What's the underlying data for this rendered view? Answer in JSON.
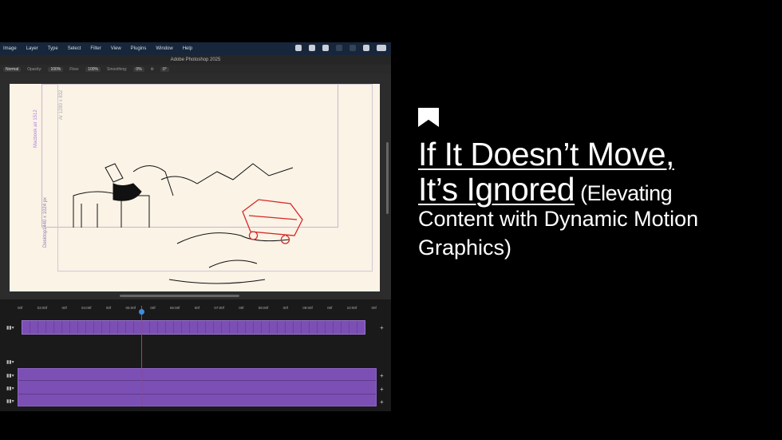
{
  "app": {
    "menu": [
      "Image",
      "Layer",
      "Type",
      "Select",
      "Filter",
      "View",
      "Plugins",
      "Window",
      "Help"
    ],
    "window_title": "Adobe Photoshop 2025",
    "options": {
      "mode": "Normal",
      "opacity_label": "Opacity:",
      "opacity": "100%",
      "flow_label": "Flow:",
      "flow": "100%",
      "smoothing_label": "Smoothing:",
      "smoothing": "0%",
      "angle": "0°"
    },
    "artboards": {
      "macbook": "Macbook air 1512",
      "ar": "Ar 1280 x 832",
      "desktop": "Desktop1440 x 1024 px"
    },
    "timeline_ticks": [
      "00f",
      "03:00f",
      "00f",
      "04:00f",
      "00f",
      "05:00f",
      "00f",
      "06:00f",
      "00f",
      "07:00f",
      "00f",
      "08:00f",
      "00f",
      "09:00f",
      "00f",
      "10:00f",
      "00f"
    ]
  },
  "article": {
    "title_line1": "If It Doesn’t Move,",
    "title_line2": "It’s Ignored",
    "subtitle_a": " (Elevating",
    "subtitle_b": "Content with Dynamic Motion Graphics)"
  },
  "colors": {
    "track": "#7b4fb3",
    "playhead": "#dd3333",
    "menubar": "#17263a"
  }
}
